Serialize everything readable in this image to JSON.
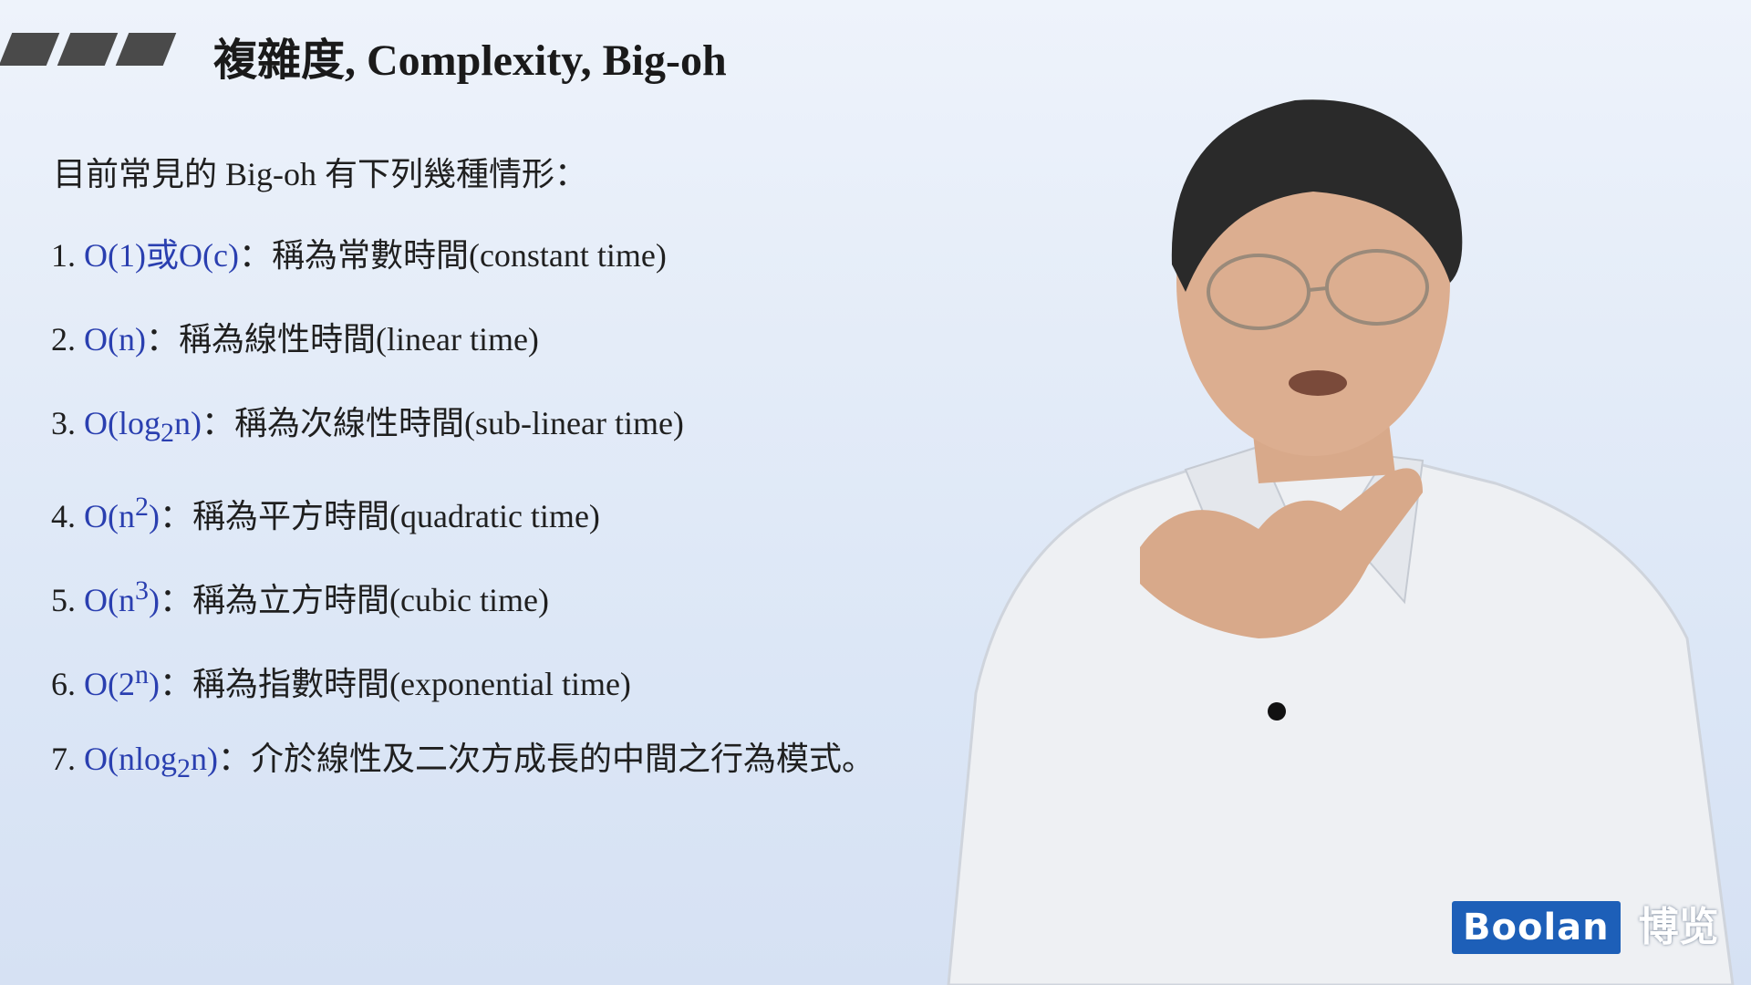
{
  "slide": {
    "title": "複雜度, Complexity, Big-oh",
    "intro": "目前常見的 Big-oh 有下列幾種情形：",
    "items": [
      {
        "num": "1.",
        "expr_html": "O(1)或O(c)",
        "sep": "：",
        "desc": "稱為常數時間(constant time)"
      },
      {
        "num": "2.",
        "expr_html": "O(n)",
        "sep": "：",
        "desc": "稱為線性時間(linear time)"
      },
      {
        "num": "3.",
        "expr_html": "O(log<sub>2</sub>n)",
        "sep": "：",
        "desc": "稱為次線性時間(sub-linear time)"
      },
      {
        "num": "4.",
        "expr_html": "O(n<sup>2</sup>)",
        "sep": "：",
        "desc": "稱為平方時間(quadratic time)"
      },
      {
        "num": "5.",
        "expr_html": "O(n<sup>3</sup>)",
        "sep": "：",
        "desc": "稱為立方時間(cubic time)"
      },
      {
        "num": "6.",
        "expr_html": "O(2<sup>n</sup>)",
        "sep": "：",
        "desc": "稱為指數時間(exponential time)"
      },
      {
        "num": "7.",
        "expr_html": "O(nlog<sub>2</sub>n)",
        "sep": "：",
        "desc": "介於線性及二次方成長的中間之行為模式。"
      }
    ]
  },
  "logo": {
    "brand": "Boolan",
    "cjk": "博览"
  },
  "colors": {
    "expression": "#2a3fb0",
    "logo_bg": "#1d5fb8"
  }
}
